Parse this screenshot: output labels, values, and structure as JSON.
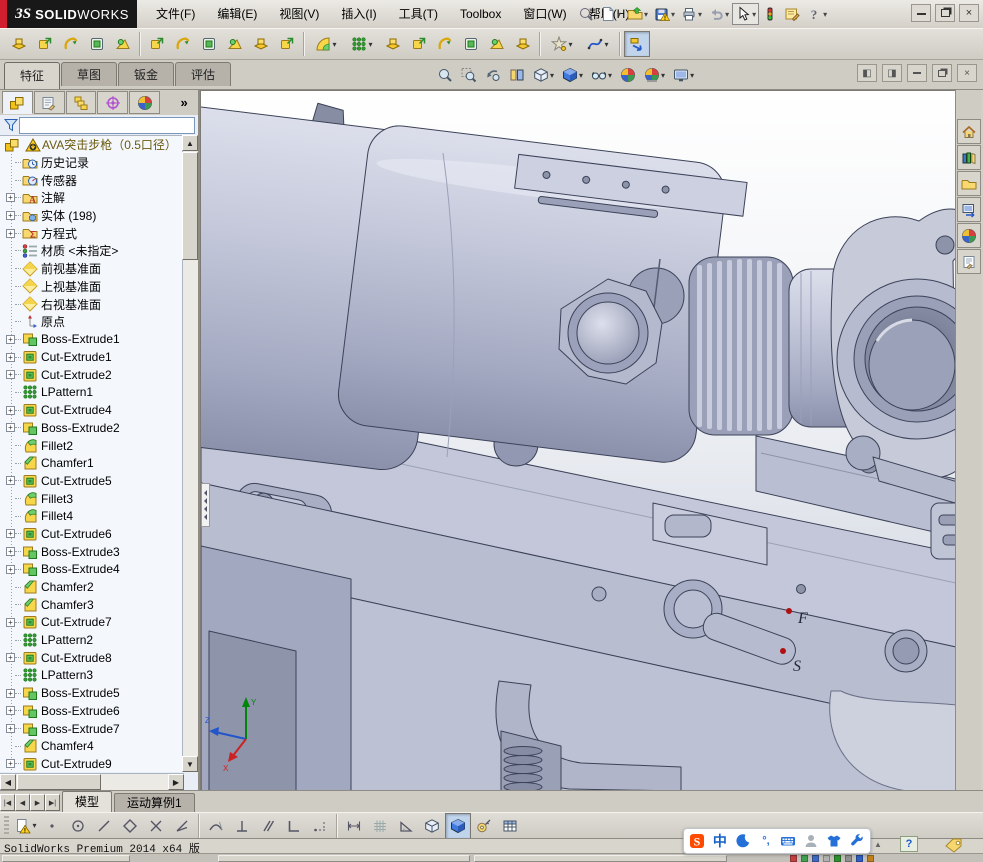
{
  "titlebar": {
    "logo_mark": "ЗS",
    "logo_bold": "SOLID",
    "logo_light": "WORKS",
    "menus": [
      "文件(F)",
      "编辑(E)",
      "视图(V)",
      "插入(I)",
      "工具(T)",
      "Toolbox",
      "窗口(W)",
      "帮助(H)"
    ],
    "quick_tools": [
      {
        "name": "search"
      },
      {
        "name": "new-document",
        "dropdown": true
      },
      {
        "name": "open-document",
        "dropdown": true
      },
      {
        "name": "save-document",
        "dropdown": true
      },
      {
        "name": "print-document",
        "dropdown": true
      },
      {
        "name": "undo",
        "dropdown": true
      },
      {
        "name": "select",
        "dropdown": true,
        "boxed": true
      },
      {
        "name": "rebuild-traffic-light"
      },
      {
        "name": "options-note"
      },
      {
        "name": "help",
        "dropdown": true
      }
    ]
  },
  "feature_toolbar": {
    "icons": [
      {
        "name": "insert-part"
      },
      {
        "name": "move-copy"
      },
      {
        "name": "flex"
      },
      {
        "name": "dome"
      },
      {
        "name": "shell"
      },
      {
        "sep": true
      },
      {
        "name": "forming-tool"
      },
      {
        "name": "sketched-bend"
      },
      {
        "name": "base-flange"
      },
      {
        "name": "swept-flange"
      },
      {
        "name": "lofted-bend"
      },
      {
        "name": "fold"
      },
      {
        "sep": true
      },
      {
        "name": "fillet",
        "dropdown": true
      },
      {
        "name": "linear-pattern",
        "dropdown": true
      },
      {
        "name": "draft"
      },
      {
        "name": "rib"
      },
      {
        "name": "wrap"
      },
      {
        "name": "intersect"
      },
      {
        "name": "mirror"
      },
      {
        "name": "combine"
      },
      {
        "sep": true
      },
      {
        "name": "reference-geometry",
        "dropdown": true
      },
      {
        "name": "spline-curves",
        "dropdown": true
      },
      {
        "sep": true
      },
      {
        "name": "instant3d",
        "pressed": true
      }
    ]
  },
  "command_manager": {
    "tabs": [
      {
        "label": "特征",
        "active": true
      },
      {
        "label": "草图",
        "active": false
      },
      {
        "label": "钣金",
        "active": false
      },
      {
        "label": "评估",
        "active": false
      }
    ],
    "view_tools": [
      {
        "name": "zoom-to-fit"
      },
      {
        "name": "zoom-to-area"
      },
      {
        "name": "previous-view"
      },
      {
        "name": "section-view"
      },
      {
        "name": "view-orientation",
        "dropdown": true
      },
      {
        "name": "display-style",
        "dropdown": true
      },
      {
        "name": "hide-show-items",
        "dropdown": true
      },
      {
        "name": "edit-appearance"
      },
      {
        "name": "apply-scene",
        "dropdown": true
      },
      {
        "name": "view-settings",
        "dropdown": true
      }
    ]
  },
  "left_pane": {
    "manager_tabs": [
      {
        "name": "featuremanager-tree",
        "active": true
      },
      {
        "name": "propertymanager"
      },
      {
        "name": "configurationmanager"
      },
      {
        "name": "dimxpertmanager"
      },
      {
        "name": "displaymanager"
      }
    ],
    "overflow_label": "»",
    "filter_value": "",
    "tree": {
      "root_label": "AVA突击步枪（0.5口径）",
      "items": [
        {
          "label": "历史记录",
          "icon": "history"
        },
        {
          "label": "传感器",
          "icon": "sensors"
        },
        {
          "label": "注解",
          "icon": "annotations",
          "expandable": true
        },
        {
          "label": "实体 (198)",
          "icon": "solids",
          "expandable": true
        },
        {
          "label": "方程式",
          "icon": "equations",
          "expandable": true
        },
        {
          "label": "材质 <未指定>",
          "icon": "material"
        },
        {
          "label": "前视基准面",
          "icon": "plane"
        },
        {
          "label": "上视基准面",
          "icon": "plane"
        },
        {
          "label": "右视基准面",
          "icon": "plane"
        },
        {
          "label": "原点",
          "icon": "origin"
        },
        {
          "label": "Boss-Extrude1",
          "icon": "boss",
          "expandable": true
        },
        {
          "label": "Cut-Extrude1",
          "icon": "cut",
          "expandable": true
        },
        {
          "label": "Cut-Extrude2",
          "icon": "cut",
          "expandable": true
        },
        {
          "label": "LPattern1",
          "icon": "lpattern"
        },
        {
          "label": "Cut-Extrude4",
          "icon": "cut",
          "expandable": true
        },
        {
          "label": "Boss-Extrude2",
          "icon": "boss",
          "expandable": true
        },
        {
          "label": "Fillet2",
          "icon": "fillet"
        },
        {
          "label": "Chamfer1",
          "icon": "chamfer"
        },
        {
          "label": "Cut-Extrude5",
          "icon": "cut",
          "expandable": true
        },
        {
          "label": "Fillet3",
          "icon": "fillet"
        },
        {
          "label": "Fillet4",
          "icon": "fillet"
        },
        {
          "label": "Cut-Extrude6",
          "icon": "cut",
          "expandable": true
        },
        {
          "label": "Boss-Extrude3",
          "icon": "boss",
          "expandable": true
        },
        {
          "label": "Boss-Extrude4",
          "icon": "boss",
          "expandable": true
        },
        {
          "label": "Chamfer2",
          "icon": "chamfer"
        },
        {
          "label": "Chamfer3",
          "icon": "chamfer"
        },
        {
          "label": "Cut-Extrude7",
          "icon": "cut",
          "expandable": true
        },
        {
          "label": "LPattern2",
          "icon": "lpattern"
        },
        {
          "label": "Cut-Extrude8",
          "icon": "cut",
          "expandable": true
        },
        {
          "label": "LPattern3",
          "icon": "lpattern"
        },
        {
          "label": "Boss-Extrude5",
          "icon": "boss",
          "expandable": true
        },
        {
          "label": "Boss-Extrude6",
          "icon": "boss",
          "expandable": true
        },
        {
          "label": "Boss-Extrude7",
          "icon": "boss",
          "expandable": true
        },
        {
          "label": "Chamfer4",
          "icon": "chamfer"
        },
        {
          "label": "Cut-Extrude9",
          "icon": "cut",
          "expandable": true
        }
      ]
    }
  },
  "viewport": {
    "markings": {
      "fire": "F",
      "safe": "S"
    },
    "triad_labels": {
      "y": "Y",
      "z": "Z",
      "x": "X"
    },
    "selection_color": "#cc7a1f"
  },
  "task_pane": {
    "icons": [
      {
        "name": "solidworks-resources-home"
      },
      {
        "name": "design-library"
      },
      {
        "name": "file-explorer"
      },
      {
        "name": "view-palette"
      },
      {
        "name": "appearances-scenes"
      },
      {
        "name": "custom-properties"
      }
    ]
  },
  "model_tabs": {
    "nav": [
      {
        "name": "first"
      },
      {
        "name": "previous"
      },
      {
        "name": "next"
      },
      {
        "name": "last"
      }
    ],
    "tabs": [
      {
        "label": "模型",
        "active": true
      },
      {
        "label": "运动算例1",
        "active": false
      }
    ]
  },
  "snap_toolbar": {
    "icons": [
      {
        "name": "rebuild-alert",
        "dropdown": true
      },
      {
        "name": "sketch-point"
      },
      {
        "name": "sketch-circle"
      },
      {
        "name": "sketch-line"
      },
      {
        "name": "sketch-polygon"
      },
      {
        "name": "sketch-cross"
      },
      {
        "name": "sketch-angle"
      },
      {
        "sep": true
      },
      {
        "name": "snap-tangent"
      },
      {
        "name": "snap-perpendicular"
      },
      {
        "name": "snap-parallel"
      },
      {
        "name": "snap-corner"
      },
      {
        "name": "snap-point-trail"
      },
      {
        "sep": true
      },
      {
        "name": "snap-length"
      },
      {
        "name": "snap-grid"
      },
      {
        "name": "snap-angle-tool"
      },
      {
        "name": "wireframe-display"
      },
      {
        "name": "shaded-display",
        "pressed": true
      },
      {
        "name": "measure"
      },
      {
        "name": "design-table"
      }
    ]
  },
  "status_bar": {
    "text": "SolidWorks Premium 2014 x64 版"
  },
  "ime_bar": {
    "chinese_label": "中",
    "icons": [
      {
        "name": "sogou-logo"
      },
      {
        "name": "chinese-mode"
      },
      {
        "name": "moon-mode"
      },
      {
        "name": "punctuation"
      },
      {
        "name": "soft-keyboard"
      },
      {
        "name": "account"
      },
      {
        "name": "skin"
      },
      {
        "name": "settings-wrench"
      }
    ],
    "help_badge": "?"
  }
}
